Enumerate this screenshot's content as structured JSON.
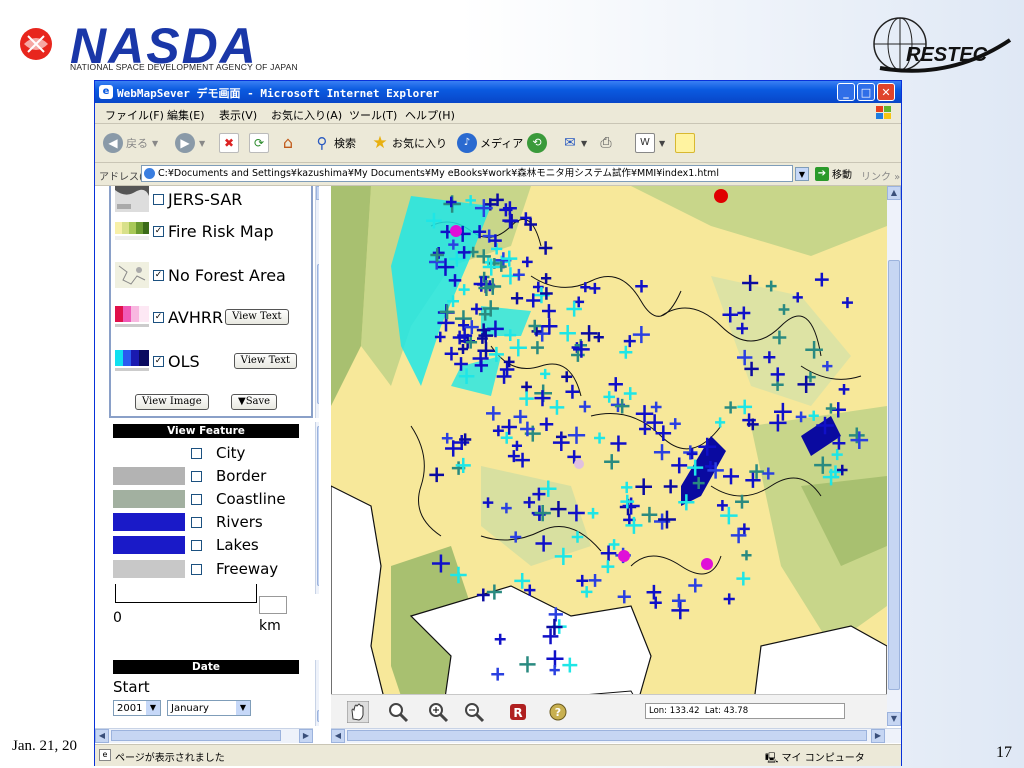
{
  "slide": {
    "org_name": "NASDA",
    "org_subtitle": "NATIONAL SPACE DEVELOPMENT AGENCY OF JAPAN",
    "partner_logo": "RESTEC",
    "footer_date": "Jan. 21, 20",
    "page_number": "17"
  },
  "window": {
    "title": "WebMapSever デモ画面 - Microsoft Internet Explorer",
    "minimize": "_",
    "maximize": "□",
    "close": "✕"
  },
  "menu": [
    "ファイル(F)",
    "編集(E)",
    "表示(V)",
    "お気に入り(A)",
    "ツール(T)",
    "ヘルプ(H)"
  ],
  "toolbar": {
    "back": "戻る",
    "search": "検索",
    "favorites": "お気に入り",
    "media": "メディア"
  },
  "address": {
    "label": "アドレス(D)",
    "url": "C:¥Documents and Settings¥kazushima¥My Documents¥My eBooks¥work¥森林モニタ用システム試作¥MMI¥index1.html",
    "go": "移動",
    "links": "リンク"
  },
  "layers": [
    {
      "label": "JERS-SAR",
      "checked": false,
      "icon": "sar-thumbnail"
    },
    {
      "label": "Fire Risk Map",
      "checked": true,
      "icon": "fire-risk-legend"
    },
    {
      "label": "No Forest Area",
      "checked": true,
      "icon": "no-forest-thumbnail"
    },
    {
      "label": "AVHRR",
      "checked": true,
      "icon": "avhrr-legend",
      "button": "View Text"
    },
    {
      "label": "OLS",
      "checked": true,
      "icon": "ols-legend",
      "button": "View Text"
    }
  ],
  "layer_actions": {
    "view_image": "View Image",
    "save": "▼Save"
  },
  "view_feature": {
    "header": "View Feature",
    "items": [
      {
        "label": "City",
        "color": "#ffffff"
      },
      {
        "label": "Border",
        "color": "#b3b3b3"
      },
      {
        "label": "Coastline",
        "color": "#a2b0a0"
      },
      {
        "label": "Rivers",
        "color": "#1a1ac8"
      },
      {
        "label": "Lakes",
        "color": "#1a1ac8"
      },
      {
        "label": "Freeway",
        "color": "#c8c8c8"
      }
    ],
    "scale_min": "0",
    "scale_unit": "km"
  },
  "date": {
    "header": "Date",
    "start_label": "Start",
    "year": "2001",
    "month": "January"
  },
  "map": {
    "lon_label": "Lon:",
    "lon": "133.42",
    "lat_label": "Lat:",
    "lat": "43.78",
    "tools": [
      "pan-hand-icon",
      "magnifier-icon",
      "zoom-in-icon",
      "zoom-out-icon",
      "reset-icon",
      "help-icon"
    ]
  },
  "status": {
    "text": "ページが表示されました",
    "zone": "マイ コンピュータ"
  },
  "colors": {
    "titlebar": "#0a5ae0",
    "land_light": "#f7e89a",
    "land_green": "#c8d68a",
    "fire_marker": "#1010c8",
    "avhrr_cyan": "#1ee6e6",
    "ocean": "#ffffff"
  }
}
